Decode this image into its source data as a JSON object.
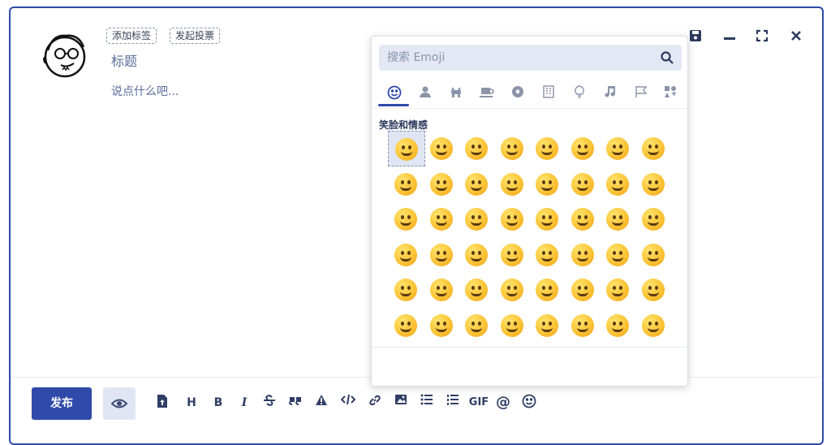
{
  "editor": {
    "tag_button": "添加标签",
    "vote_button": "发起投票",
    "title_placeholder": "标题",
    "content_placeholder": "说点什么吧..."
  },
  "window_controls": [
    "save-icon",
    "minimize-icon",
    "fullscreen-icon",
    "close-icon"
  ],
  "toolbar": {
    "publish_label": "发布",
    "items": [
      "upload-icon",
      "H",
      "B",
      "I",
      "strikethrough-icon",
      "quote-icon",
      "warning-icon",
      "code-icon",
      "link-icon",
      "image-icon",
      "bullet-list-icon",
      "numbered-list-icon",
      "GIF",
      "@",
      "emoji-icon"
    ]
  },
  "emoji_panel": {
    "search_placeholder": "搜索 Emoji",
    "categories": [
      "smiley",
      "people",
      "animals",
      "food",
      "activity",
      "buildings",
      "objects",
      "music",
      "flags",
      "symbols"
    ],
    "section_title": "笑脸和情感",
    "rows": 6,
    "columns": 8,
    "selected_index": 0
  },
  "colors": {
    "accent": "#2f4aa8",
    "panel_bg": "#ffffff",
    "search_bg": "#e3e8f4"
  }
}
